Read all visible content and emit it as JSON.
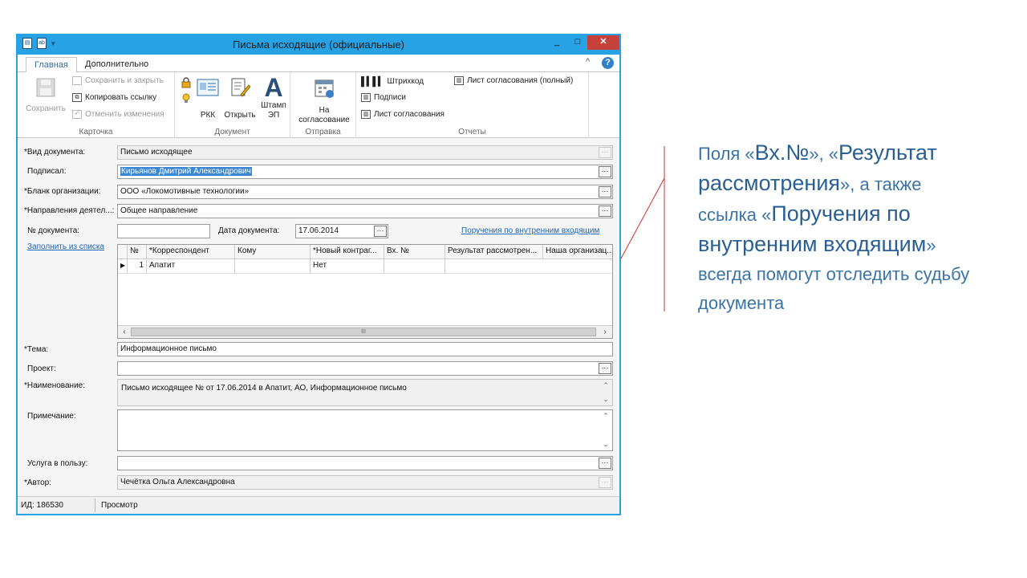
{
  "window": {
    "title": "Письма исходящие (официальные)",
    "min": "_",
    "max": "□",
    "close": "✕"
  },
  "tabs": [
    {
      "label": "Главная"
    },
    {
      "label": "Дополнительно"
    }
  ],
  "ribbon": {
    "collapse": "^",
    "help": "?",
    "groups": {
      "card": {
        "label": "Карточка",
        "save": "Сохранить",
        "save_close": "Сохранить и закрыть",
        "copy_link": "Копировать ссылку",
        "undo": "Отменить изменения"
      },
      "document": {
        "label": "Документ",
        "rkk": "РКК",
        "open": "Открыть",
        "stamp_l1": "Штамп",
        "stamp_l2": "ЭП"
      },
      "send": {
        "label": "Отправка",
        "approve_l1": "На",
        "approve_l2": "согласование"
      },
      "reports": {
        "label": "Отчеты",
        "barcode": "Штрихкод",
        "signatures": "Подписи",
        "approval_sheet": "Лист согласования",
        "approval_sheet_full": "Лист согласования (полный)"
      }
    }
  },
  "form": {
    "doc_type": {
      "label": "*Вид документа:",
      "value": "Письмо исходящее"
    },
    "signed": {
      "label": "Подписал:",
      "value": "Кирьянов Дмитрий Александрович"
    },
    "org_form": {
      "label": "*Бланк организации:",
      "value": "ООО «Локомотивные технологии»"
    },
    "direction": {
      "label": "*Направления деятел...:",
      "value": "Общее направление"
    },
    "doc_no": {
      "label": "№ документа:",
      "value": ""
    },
    "doc_date": {
      "label": "Дата документа:",
      "value": "17.06.2014"
    },
    "inner_link": "Поручения по внутренним входящим",
    "fill_link": "Заполнить из списка",
    "grid": {
      "columns": [
        "№",
        "*Корреспондент",
        "Кому",
        "*Новый контраг...",
        "Вх. №",
        "Результат рассмотрен...",
        "Наша организац..."
      ],
      "rows": [
        [
          "1",
          "Апатит",
          "",
          "Нет",
          "",
          "",
          ""
        ]
      ],
      "scroll_thumb": "III"
    },
    "subject": {
      "label": "*Тема:",
      "value": "Информационное письмо"
    },
    "project": {
      "label": "Проект:",
      "value": ""
    },
    "name": {
      "label": "*Наименование:",
      "value": "Письмо исходящее №  от 17.06.2014 в Апатит, АО,  Информационное письмо"
    },
    "note": {
      "label": "Примечание:",
      "value": ""
    },
    "service": {
      "label": "Услуга в пользу:",
      "value": ""
    },
    "author": {
      "label": "*Автор:",
      "value": "Чечётка Ольга Александровна"
    }
  },
  "status": {
    "id": "ИД: 186530",
    "mode": "Просмотр"
  },
  "annotation": {
    "p1": "Поля «",
    "e1": "Вх.№",
    "p2": "», «",
    "e2": "Результат рассмотрения",
    "p3": "», а также ссылка «",
    "e3": "Поручения по внутренним входящим",
    "p4": "» всегда помогут отследить судьбу документа"
  },
  "colors": {
    "title_bar": "#27a2e5",
    "close_button": "#c7403a",
    "link": "#2265b8",
    "annotation_text": "#3a73a8",
    "pointer_line": "#d03030"
  }
}
